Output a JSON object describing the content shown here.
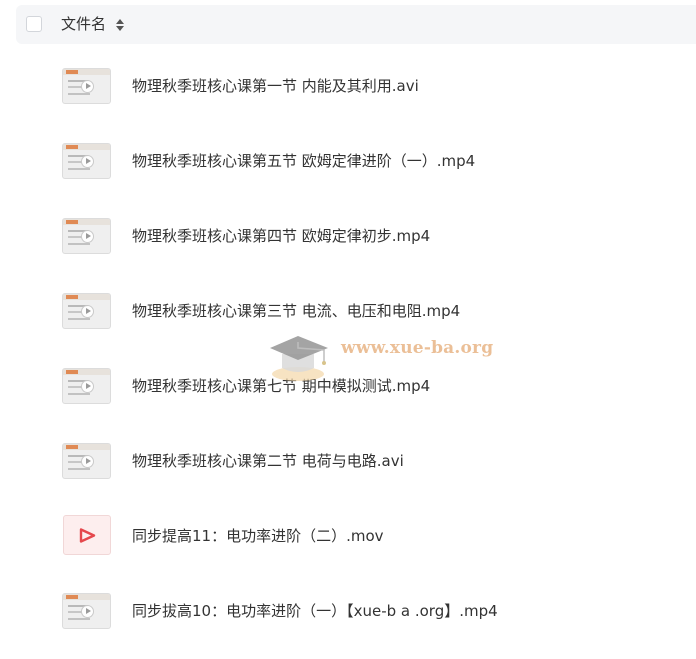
{
  "header": {
    "title": "文件名"
  },
  "files": [
    {
      "name": "物理秋季班核心课第一节 内能及其利用.avi",
      "kind": "video"
    },
    {
      "name": "物理秋季班核心课第五节 欧姆定律进阶（一）.mp4",
      "kind": "video"
    },
    {
      "name": "物理秋季班核心课第四节 欧姆定律初步.mp4",
      "kind": "video"
    },
    {
      "name": "物理秋季班核心课第三节 电流、电压和电阻.mp4",
      "kind": "video"
    },
    {
      "name": "物理秋季班核心课第七节 期中模拟测试.mp4",
      "kind": "video"
    },
    {
      "name": "物理秋季班核心课第二节 电荷与电路.avi",
      "kind": "video"
    },
    {
      "name": "同步提高11：电功率进阶（二）.mov",
      "kind": "mov"
    },
    {
      "name": "同步拔高10：电功率进阶（一）【xue-b a .org】.mp4",
      "kind": "video"
    }
  ],
  "watermark": {
    "text": "www.xue-ba.org"
  },
  "colors": {
    "header_bg": "#f5f6f8",
    "mov_icon": "#e5484d",
    "watermark": "#e9b98c"
  }
}
